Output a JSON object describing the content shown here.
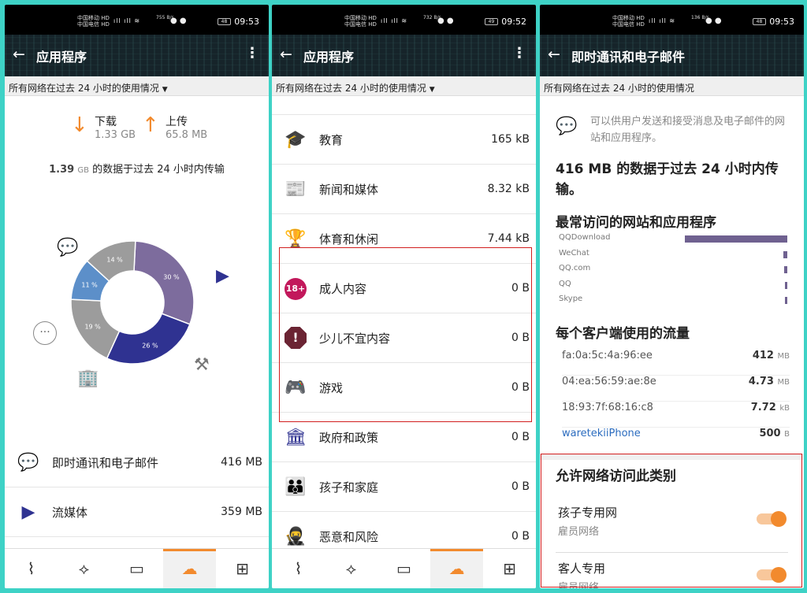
{
  "status": [
    {
      "carrier1": "中国移动 HD",
      "carrier2": "中国电信 HD",
      "speed": "755 B/s",
      "battery": "48",
      "time": "09:53"
    },
    {
      "carrier1": "中国移动 HD",
      "carrier2": "中国电信 HD",
      "speed": "732 B/s",
      "battery": "49",
      "time": "09:52"
    },
    {
      "carrier1": "中国移动 HD",
      "carrier2": "中国电信 HD",
      "speed": "136 B/s",
      "battery": "48",
      "time": "09:53"
    }
  ],
  "screen1": {
    "title": "应用程序",
    "filter": "所有网络在过去 24 小时的使用情况",
    "download_label": "下载",
    "download_value": "1.33 GB",
    "upload_label": "上传",
    "upload_value": "65.8 MB",
    "summary_value": "1.39",
    "summary_unit": "GB",
    "summary_text": " 的数据于过去 24 小时内传输",
    "chart_data": {
      "type": "pie",
      "values": [
        30,
        26,
        19,
        11,
        14
      ],
      "labels": [
        "30 %",
        "26 %",
        "19 %",
        "11 %",
        "14 %"
      ],
      "colors": [
        "#7d6c9d",
        "#2f3291",
        "#9c9c9c",
        "#5c8fc9",
        "#9c9c9c"
      ]
    },
    "rows": [
      {
        "icon": "chat-icon",
        "name": "即时通讯和电子邮件",
        "size": "416 MB"
      },
      {
        "icon": "media-icon",
        "name": "流媒体",
        "size": "359 MB"
      }
    ]
  },
  "screen2": {
    "title": "应用程序",
    "filter": "所有网络在过去 24 小时的使用情况",
    "rows": [
      {
        "name": "教育",
        "size": "165 kB"
      },
      {
        "name": "新闻和媒体",
        "size": "8.32 kB"
      },
      {
        "name": "体育和休闲",
        "size": "7.44 kB"
      },
      {
        "name": "成人内容",
        "size": "0 B"
      },
      {
        "name": "少儿不宜内容",
        "size": "0 B"
      },
      {
        "name": "游戏",
        "size": "0 B"
      },
      {
        "name": "政府和政策",
        "size": "0 B"
      },
      {
        "name": "孩子和家庭",
        "size": "0 B"
      },
      {
        "name": "恶意和风险",
        "size": "0 B"
      }
    ]
  },
  "screen3": {
    "title": "即时通讯和电子邮件",
    "filter": "所有网络在过去 24 小时的使用情况",
    "desc": "可以供用户发送和接受消息及电子邮件的网站和应用程序。",
    "amount_line": "416 MB 的数据于过去 24 小时内传输。",
    "top_heading": "最常访问的网站和应用程序",
    "sites": [
      {
        "name": "QQDownload",
        "pct": 100
      },
      {
        "name": "WeChat",
        "pct": 4
      },
      {
        "name": "QQ.com",
        "pct": 3
      },
      {
        "name": "QQ",
        "pct": 2
      },
      {
        "name": "Skype",
        "pct": 2
      }
    ],
    "client_heading": "每个客户端使用的流量",
    "clients": [
      {
        "name": "fa:0a:5c:4a:96:ee",
        "value": "412",
        "unit": "MB"
      },
      {
        "name": "04:ea:56:59:ae:8e",
        "value": "4.73",
        "unit": "MB"
      },
      {
        "name": "18:93:7f:68:16:c8",
        "value": "7.72",
        "unit": "kB"
      },
      {
        "name": "waretekiiPhone",
        "value": "500",
        "unit": "B"
      }
    ],
    "allow_heading": "允许网络访问此类别",
    "networks": [
      {
        "name": "孩子专用网",
        "sub": "雇员网络"
      },
      {
        "name": "客人专用",
        "sub": "雇员网络"
      }
    ]
  }
}
